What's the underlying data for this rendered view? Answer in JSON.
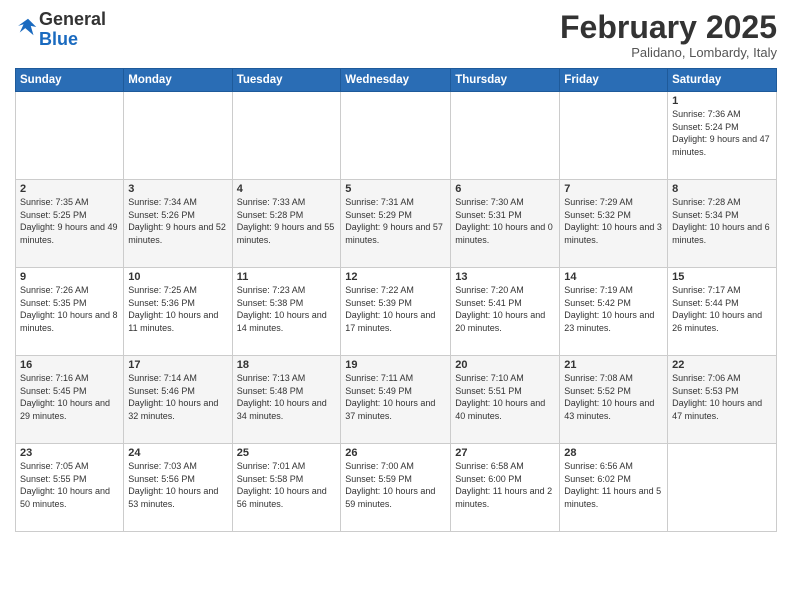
{
  "header": {
    "logo_general": "General",
    "logo_blue": "Blue",
    "month_title": "February 2025",
    "subtitle": "Palidano, Lombardy, Italy"
  },
  "weekdays": [
    "Sunday",
    "Monday",
    "Tuesday",
    "Wednesday",
    "Thursday",
    "Friday",
    "Saturday"
  ],
  "weeks": [
    [
      {
        "day": "",
        "info": ""
      },
      {
        "day": "",
        "info": ""
      },
      {
        "day": "",
        "info": ""
      },
      {
        "day": "",
        "info": ""
      },
      {
        "day": "",
        "info": ""
      },
      {
        "day": "",
        "info": ""
      },
      {
        "day": "1",
        "info": "Sunrise: 7:36 AM\nSunset: 5:24 PM\nDaylight: 9 hours and 47 minutes."
      }
    ],
    [
      {
        "day": "2",
        "info": "Sunrise: 7:35 AM\nSunset: 5:25 PM\nDaylight: 9 hours and 49 minutes."
      },
      {
        "day": "3",
        "info": "Sunrise: 7:34 AM\nSunset: 5:26 PM\nDaylight: 9 hours and 52 minutes."
      },
      {
        "day": "4",
        "info": "Sunrise: 7:33 AM\nSunset: 5:28 PM\nDaylight: 9 hours and 55 minutes."
      },
      {
        "day": "5",
        "info": "Sunrise: 7:31 AM\nSunset: 5:29 PM\nDaylight: 9 hours and 57 minutes."
      },
      {
        "day": "6",
        "info": "Sunrise: 7:30 AM\nSunset: 5:31 PM\nDaylight: 10 hours and 0 minutes."
      },
      {
        "day": "7",
        "info": "Sunrise: 7:29 AM\nSunset: 5:32 PM\nDaylight: 10 hours and 3 minutes."
      },
      {
        "day": "8",
        "info": "Sunrise: 7:28 AM\nSunset: 5:34 PM\nDaylight: 10 hours and 6 minutes."
      }
    ],
    [
      {
        "day": "9",
        "info": "Sunrise: 7:26 AM\nSunset: 5:35 PM\nDaylight: 10 hours and 8 minutes."
      },
      {
        "day": "10",
        "info": "Sunrise: 7:25 AM\nSunset: 5:36 PM\nDaylight: 10 hours and 11 minutes."
      },
      {
        "day": "11",
        "info": "Sunrise: 7:23 AM\nSunset: 5:38 PM\nDaylight: 10 hours and 14 minutes."
      },
      {
        "day": "12",
        "info": "Sunrise: 7:22 AM\nSunset: 5:39 PM\nDaylight: 10 hours and 17 minutes."
      },
      {
        "day": "13",
        "info": "Sunrise: 7:20 AM\nSunset: 5:41 PM\nDaylight: 10 hours and 20 minutes."
      },
      {
        "day": "14",
        "info": "Sunrise: 7:19 AM\nSunset: 5:42 PM\nDaylight: 10 hours and 23 minutes."
      },
      {
        "day": "15",
        "info": "Sunrise: 7:17 AM\nSunset: 5:44 PM\nDaylight: 10 hours and 26 minutes."
      }
    ],
    [
      {
        "day": "16",
        "info": "Sunrise: 7:16 AM\nSunset: 5:45 PM\nDaylight: 10 hours and 29 minutes."
      },
      {
        "day": "17",
        "info": "Sunrise: 7:14 AM\nSunset: 5:46 PM\nDaylight: 10 hours and 32 minutes."
      },
      {
        "day": "18",
        "info": "Sunrise: 7:13 AM\nSunset: 5:48 PM\nDaylight: 10 hours and 34 minutes."
      },
      {
        "day": "19",
        "info": "Sunrise: 7:11 AM\nSunset: 5:49 PM\nDaylight: 10 hours and 37 minutes."
      },
      {
        "day": "20",
        "info": "Sunrise: 7:10 AM\nSunset: 5:51 PM\nDaylight: 10 hours and 40 minutes."
      },
      {
        "day": "21",
        "info": "Sunrise: 7:08 AM\nSunset: 5:52 PM\nDaylight: 10 hours and 43 minutes."
      },
      {
        "day": "22",
        "info": "Sunrise: 7:06 AM\nSunset: 5:53 PM\nDaylight: 10 hours and 47 minutes."
      }
    ],
    [
      {
        "day": "23",
        "info": "Sunrise: 7:05 AM\nSunset: 5:55 PM\nDaylight: 10 hours and 50 minutes."
      },
      {
        "day": "24",
        "info": "Sunrise: 7:03 AM\nSunset: 5:56 PM\nDaylight: 10 hours and 53 minutes."
      },
      {
        "day": "25",
        "info": "Sunrise: 7:01 AM\nSunset: 5:58 PM\nDaylight: 10 hours and 56 minutes."
      },
      {
        "day": "26",
        "info": "Sunrise: 7:00 AM\nSunset: 5:59 PM\nDaylight: 10 hours and 59 minutes."
      },
      {
        "day": "27",
        "info": "Sunrise: 6:58 AM\nSunset: 6:00 PM\nDaylight: 11 hours and 2 minutes."
      },
      {
        "day": "28",
        "info": "Sunrise: 6:56 AM\nSunset: 6:02 PM\nDaylight: 11 hours and 5 minutes."
      },
      {
        "day": "",
        "info": ""
      }
    ]
  ]
}
